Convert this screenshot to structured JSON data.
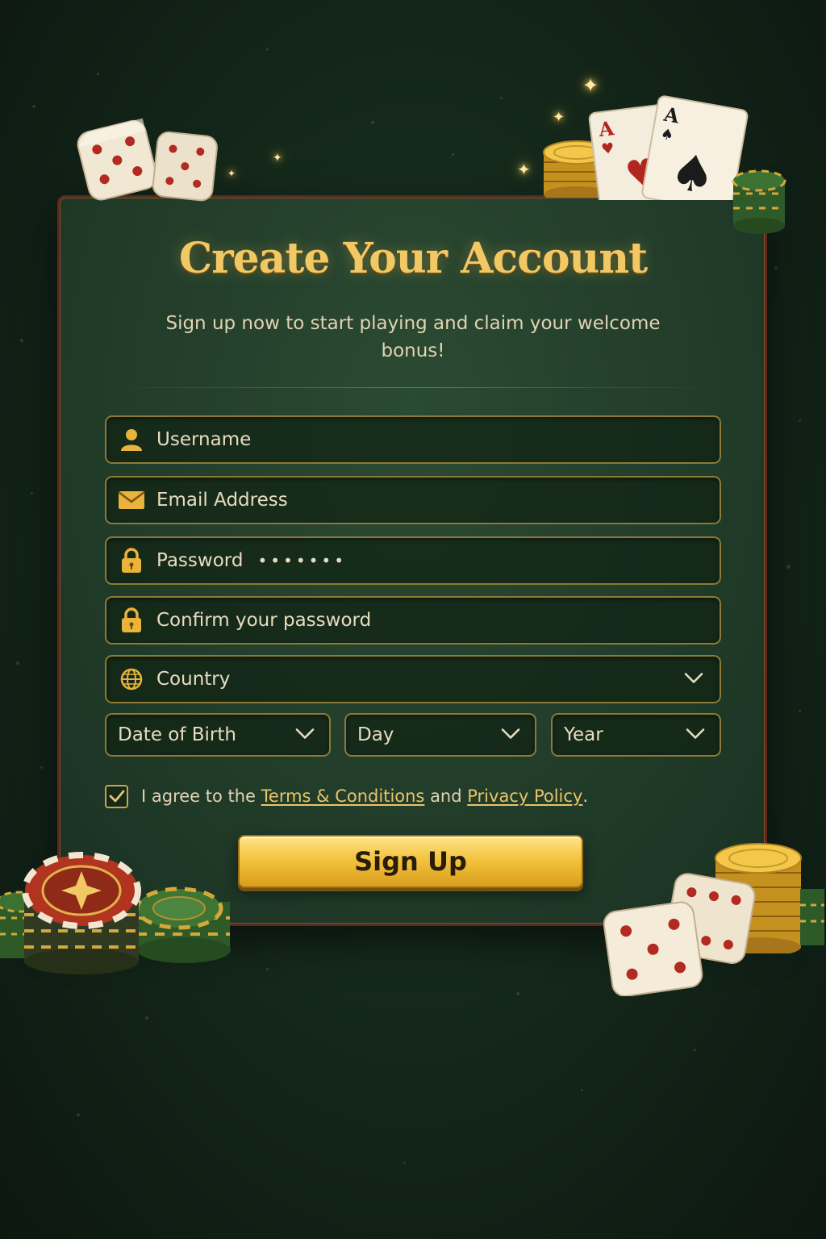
{
  "form": {
    "title": "Create Your Account",
    "subtitle": "Sign up now to start playing and claim your welcome bonus!",
    "username": {
      "placeholder": "Username",
      "icon": "user-icon"
    },
    "email": {
      "placeholder": "Email Address",
      "icon": "envelope-icon"
    },
    "password": {
      "label": "Password",
      "masked_value": "•••••••",
      "icon": "lock-icon"
    },
    "confirm_password": {
      "placeholder": "Confirm your password",
      "icon": "lock-icon"
    },
    "country": {
      "selected": "Country",
      "icon": "globe-icon"
    },
    "dob": {
      "month": "Date of Birth",
      "day": "Day",
      "year": "Year"
    },
    "agreement": {
      "checked": true,
      "prefix": "I agree to the ",
      "terms_link": "Terms & Conditions",
      "middle": " and ",
      "privacy_link": "Privacy Policy",
      "suffix": "."
    },
    "submit_label": "Sign Up"
  },
  "decor": {
    "cards": [
      {
        "rank": "A",
        "suit": "♥"
      },
      {
        "rank": "A",
        "suit": "♠"
      }
    ]
  },
  "colors": {
    "accent_gold": "#f2c865",
    "field_border": "#8c7a35",
    "panel_green": "#223d2a",
    "panel_border": "#5a2a1c"
  }
}
